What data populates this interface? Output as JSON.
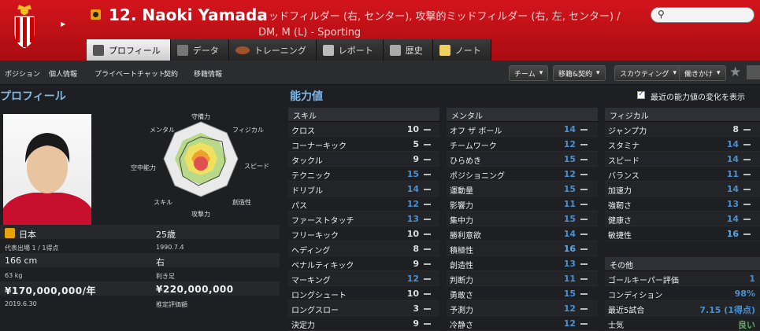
{
  "header": {
    "name": "12. Naoki Yamada",
    "positions": "ミッドフィルダー (右, センター), 攻撃的ミッドフィルダー (右, 左, センター) / DM, M (L) - Sporting",
    "club_name": "Sporting"
  },
  "tabs": [
    {
      "label": "プロフィール",
      "active": true
    },
    {
      "label": "データ"
    },
    {
      "label": "トレーニング"
    },
    {
      "label": "レポート"
    },
    {
      "label": "歴史"
    },
    {
      "label": "ノート"
    }
  ],
  "subnav": {
    "links": [
      "ポジション",
      "個人情報",
      "プライベートチャット",
      "契約",
      "移籍情報"
    ],
    "dropdowns": [
      "チーム",
      "移籍&契約",
      "スカウティング",
      "働きかけ"
    ]
  },
  "profile": {
    "title": "プロフィール",
    "radar_labels": [
      "守備力",
      "フィジカル",
      "スピード",
      "創造性",
      "攻撃力",
      "スキル",
      "空中能力",
      "メンタル"
    ],
    "nationality": "日本",
    "age": "25歳",
    "caps": "代表出場 1 / 1得点",
    "dob": "1990.7.4",
    "height": "166 cm",
    "foot": "右",
    "weight": "63 kg",
    "foot_label": "利き足",
    "wage": "¥170,000,000/年",
    "value": "¥220,000,000",
    "contract": "2019.6.30",
    "value_label": "推定評価額"
  },
  "attributes": {
    "title": "能力値",
    "show_changes_label": "最近の能力値の変化を表示",
    "skill": {
      "title": "スキル",
      "rows": [
        [
          "クロス",
          "10"
        ],
        [
          "コーナーキック",
          "5"
        ],
        [
          "タックル",
          "9"
        ],
        [
          "テクニック",
          "15"
        ],
        [
          "ドリブル",
          "14"
        ],
        [
          "パス",
          "12"
        ],
        [
          "ファーストタッチ",
          "13"
        ],
        [
          "フリーキック",
          "10"
        ],
        [
          "ヘディング",
          "8"
        ],
        [
          "ペナルティキック",
          "9"
        ],
        [
          "マーキング",
          "12"
        ],
        [
          "ロングシュート",
          "10"
        ],
        [
          "ロングスロー",
          "3"
        ],
        [
          "決定力",
          "9"
        ]
      ]
    },
    "mental": {
      "title": "メンタル",
      "rows": [
        [
          "オフ ザ ボール",
          "14"
        ],
        [
          "チームワーク",
          "12"
        ],
        [
          "ひらめき",
          "15"
        ],
        [
          "ポジショニング",
          "12"
        ],
        [
          "運動量",
          "15"
        ],
        [
          "影響力",
          "11"
        ],
        [
          "集中力",
          "15"
        ],
        [
          "勝利意欲",
          "14"
        ],
        [
          "積極性",
          "16"
        ],
        [
          "創造性",
          "13"
        ],
        [
          "判断力",
          "11"
        ],
        [
          "勇敢さ",
          "15"
        ],
        [
          "予測力",
          "12"
        ],
        [
          "冷静さ",
          "12"
        ]
      ]
    },
    "physical": {
      "title": "フィジカル",
      "rows": [
        [
          "ジャンプ力",
          "8"
        ],
        [
          "スタミナ",
          "14"
        ],
        [
          "スピード",
          "14"
        ],
        [
          "バランス",
          "11"
        ],
        [
          "加速力",
          "14"
        ],
        [
          "強靭さ",
          "13"
        ],
        [
          "健康さ",
          "14"
        ],
        [
          "敏捷性",
          "16"
        ]
      ]
    },
    "other": {
      "title": "その他",
      "rows": [
        [
          "ゴールキーパー評価",
          "1"
        ],
        [
          "コンディション",
          "98%"
        ],
        [
          "最近5試合",
          "7.15 (1得点)"
        ],
        [
          "士気",
          "良い"
        ]
      ]
    }
  }
}
